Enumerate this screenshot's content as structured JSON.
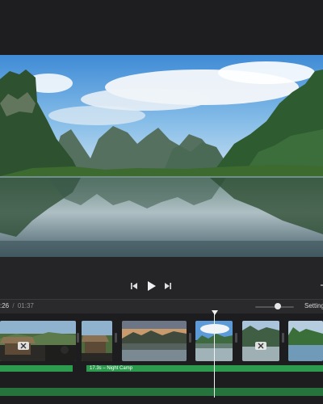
{
  "player": {
    "buttons": {
      "skip_back_icon": "skip-back-icon",
      "play_icon": "play-icon",
      "skip_forward_icon": "skip-forward-icon"
    }
  },
  "timebar": {
    "current_time": ":26",
    "separator": "/",
    "total_time": "01:37",
    "settings_label": "Setting",
    "zoom_level": 0.58
  },
  "timeline": {
    "audio_label": "17.3s – Night Camp",
    "clips": [
      {
        "id": "clip-1",
        "icon": "cut-icon"
      },
      {
        "id": "clip-2",
        "icon": "cut-icon"
      },
      {
        "id": "clip-3"
      },
      {
        "id": "clip-4"
      },
      {
        "id": "clip-5",
        "icon": "cut-icon"
      },
      {
        "id": "clip-6"
      }
    ]
  },
  "colors": {
    "accent_green": "#2d9b4e",
    "music_green": "#27733d",
    "background": "#1b1b1d"
  }
}
